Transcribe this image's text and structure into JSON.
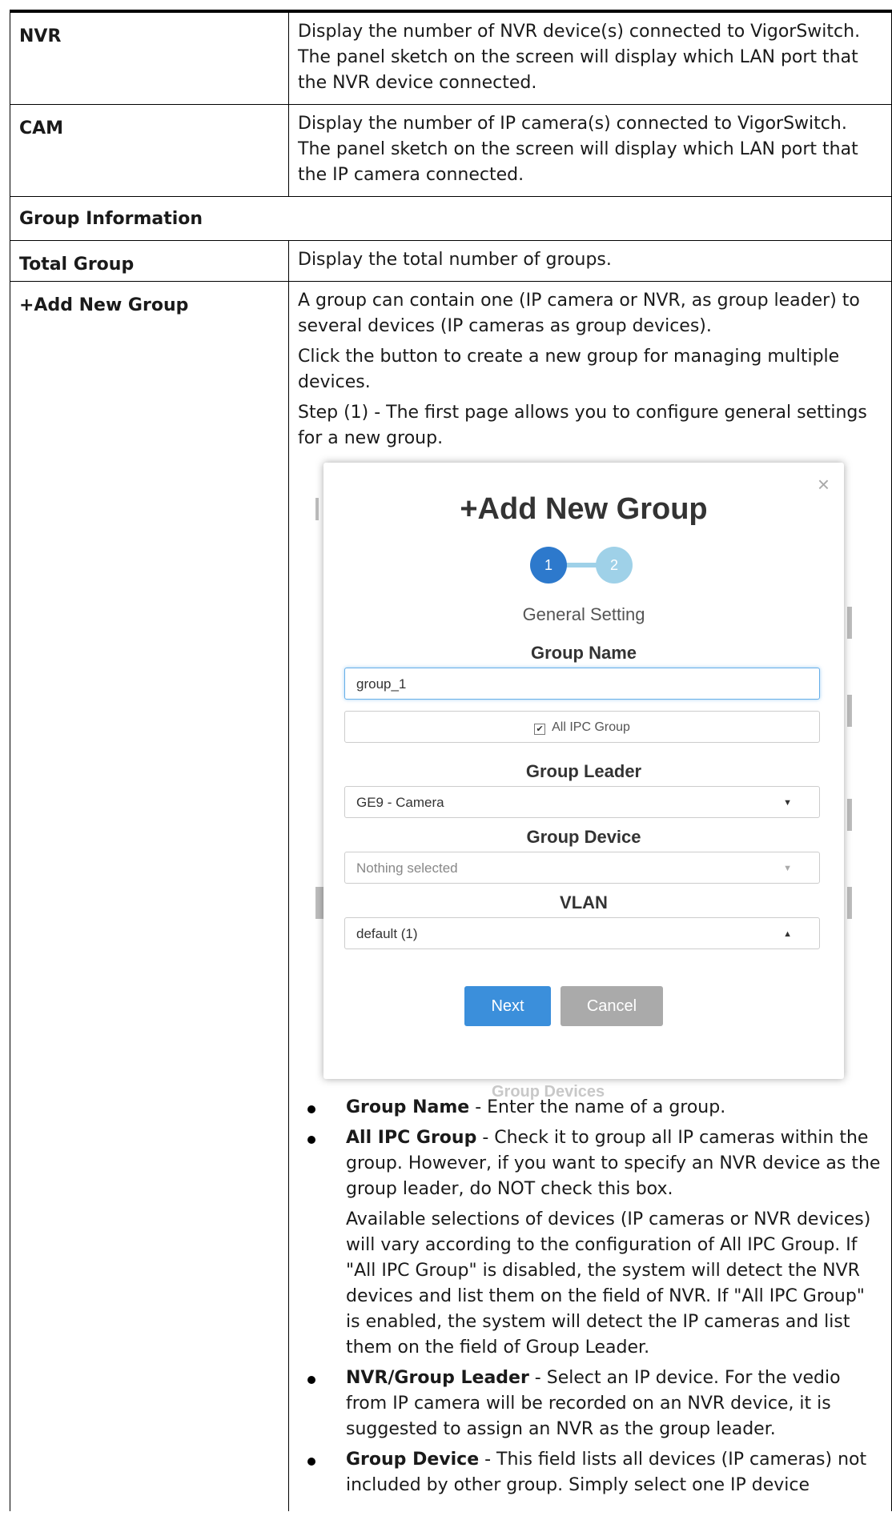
{
  "rows": {
    "nvr": {
      "key": "NVR",
      "desc": "Display the number of NVR device(s) connected to VigorSwitch. The panel sketch on the screen will display which LAN port that the NVR device connected."
    },
    "cam": {
      "key": "CAM",
      "desc": "Display the number of IP camera(s) connected to VigorSwitch. The panel sketch on the screen will display which LAN port that the IP camera connected."
    },
    "section": "Group Information",
    "total_group": {
      "key": "Total Group",
      "desc": "Display the total number of groups."
    },
    "add_group": {
      "key": "+Add New Group",
      "p1": "A group can contain one (IP camera or NVR, as group leader) to several devices (IP cameras as group devices).",
      "p2": "Click the button to create a new group for managing multiple devices.",
      "p3": "Step (1) - The first page allows you to configure general settings for a new group."
    }
  },
  "dialog": {
    "close_glyph": "×",
    "title": "+Add New Group",
    "step1": "1",
    "step2": "2",
    "subtitle": "General Setting",
    "group_name_label": "Group Name",
    "group_name_value": "group_1",
    "check_mark": "✔",
    "all_ipc_label": "All IPC Group",
    "leader_label": "Group Leader",
    "leader_value": "GE9 - Camera",
    "device_label": "Group Device",
    "device_placeholder": "Nothing selected",
    "vlan_label": "VLAN",
    "vlan_value": "default (1)",
    "caret_down": "▼",
    "caret_up": "▲",
    "next": "Next",
    "cancel": "Cancel",
    "peek_text": "Group Devices"
  },
  "bullets": [
    {
      "term": "Group Name",
      "text": " - Enter the name of a group."
    },
    {
      "term": "All IPC Group",
      "text": " - Check it to group all IP cameras within the group. However, if you want to specify an NVR device as the group leader, do NOT check this box.",
      "extra": "Available selections of devices (IP cameras or NVR devices) will vary according to the configuration of All IPC Group. If \"All IPC Group\" is disabled, the system will detect the NVR devices and list them on the field of NVR. If \"All IPC Group\" is enabled, the system will detect the IP cameras and list them on the field of Group Leader."
    },
    {
      "term": "NVR/Group Leader",
      "text": " - Select an IP device. For the vedio from IP camera will be recorded on an NVR device, it is suggested to assign an NVR as the group leader."
    },
    {
      "term": "Group Device",
      "text": " - This field lists all devices (IP cameras) not included by other group. Simply select one IP device"
    }
  ]
}
